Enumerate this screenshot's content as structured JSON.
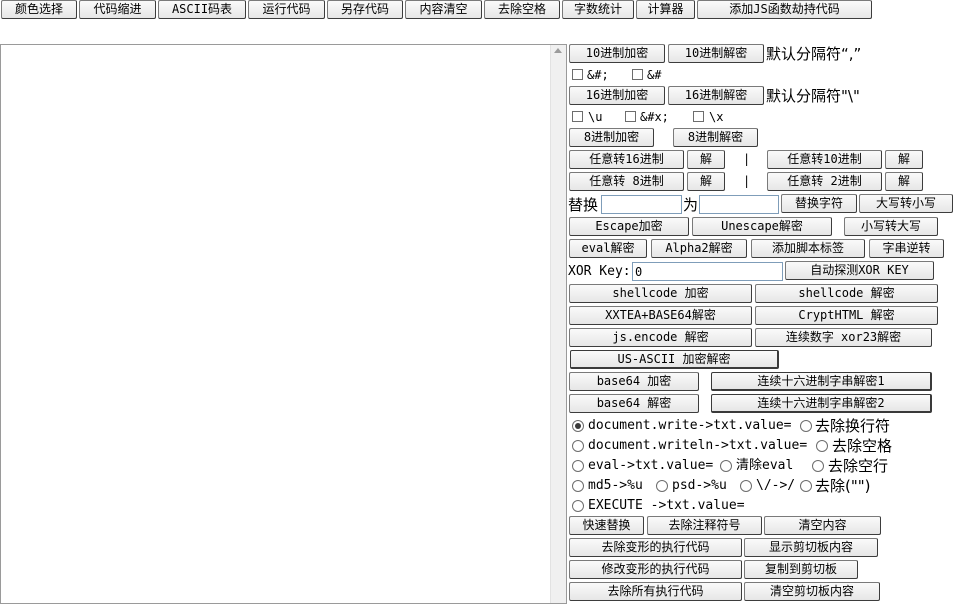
{
  "toolbar": [
    "颜色选择",
    "代码缩进",
    "ASCII码表",
    "运行代码",
    "另存代码",
    "内容清空",
    "去除空格",
    "字数统计",
    "计算器",
    "添加JS函数劫持代码"
  ],
  "dec": {
    "encode": "10进制加密",
    "decode": "10进制解密",
    "sep": "默认分隔符“,”",
    "opt1": "&#;",
    "opt2": "&#"
  },
  "hex": {
    "encode": "16进制加密",
    "decode": "16进制解密",
    "sep": "默认分隔符\"\\\"",
    "opt1": "\\u",
    "opt2": "&#x;",
    "opt3": "\\x"
  },
  "oct": {
    "encode": "8进制加密",
    "decode": "8进制解密"
  },
  "anyto": {
    "to16": "任意转16进制",
    "to10": "任意转10进制",
    "to8": "任意转 8进制",
    "to2": "任意转 2进制",
    "dec": "解",
    "sep": "|"
  },
  "replace": {
    "label1": "替换",
    "label2": "为",
    "btn": "替换字符",
    "upper2lower": "大写转小写",
    "lower2upper": "小写转大写"
  },
  "escape": {
    "enc": "Escape加密",
    "unesc": "Unescape解密"
  },
  "misc": {
    "eval": "eval解密",
    "alpha2": "Alpha2解密",
    "addscript": "添加脚本标签",
    "reverse": "字串逆转"
  },
  "xor": {
    "label": "XOR Key:",
    "value": "0",
    "detect": "自动探测XOR KEY"
  },
  "codec": {
    "sc_enc": "shellcode 加密",
    "sc_dec": "shellcode 解密",
    "xxtea": "XXTEA+BASE64解密",
    "crypt": "CryptHTML 解密",
    "jsenc": "js.encode 解密",
    "xor23": "连续数字 xor23解密",
    "usascii": "US-ASCII 加密解密",
    "b64enc": "base64 加密",
    "b64dec": "base64 解密",
    "hex1": "连续十六进制字串解密1",
    "hex2": "连续十六进制字串解密2"
  },
  "radios": {
    "dw": "document.write->txt.value=",
    "rm_newline": "去除换行符",
    "dwln": "document.writeln->txt.value=",
    "rm_space": "去除空格",
    "ev": "eval->txt.value=",
    "clear_eval": "清除eval",
    "rm_blank": "去除空行",
    "md5": "md5->%u",
    "psd": "psd->%u",
    "slash": "\\/->/",
    "rm_quote": "去除(\"\")",
    "exec": "EXECUTE ->txt.value="
  },
  "bottom": {
    "quick": "快速替换",
    "rm_comment": "去除注释符号",
    "clear": "清空内容",
    "rm_deform": "去除变形的执行代码",
    "show_clip": "显示剪切板内容",
    "mod_deform": "修改变形的执行代码",
    "copy_clip": "复制到剪切板",
    "rm_all": "去除所有执行代码",
    "clear_clip": "清空剪切板内容"
  }
}
